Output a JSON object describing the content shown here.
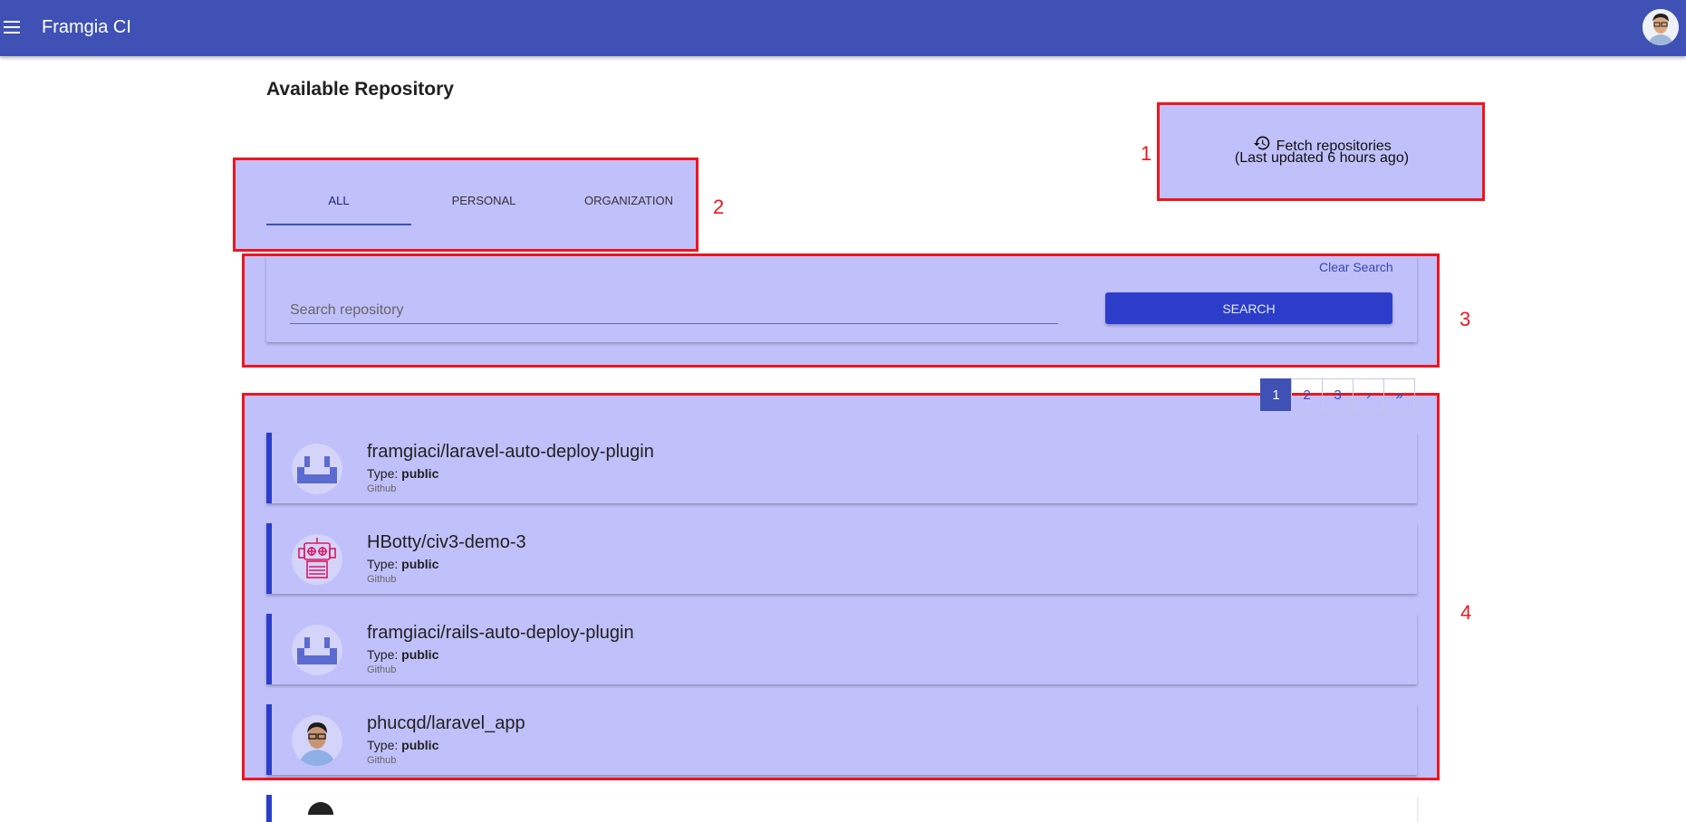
{
  "app": {
    "title": "Framgia CI"
  },
  "page": {
    "title": "Available Repository"
  },
  "fetch": {
    "label": "Fetch repositories",
    "last_updated": "(Last updated 6 hours ago)"
  },
  "tabs": [
    {
      "label": "ALL",
      "active": true
    },
    {
      "label": "PERSONAL",
      "active": false
    },
    {
      "label": "ORGANIZATION",
      "active": false
    }
  ],
  "search": {
    "clear_label": "Clear Search",
    "placeholder": "Search repository",
    "value": "",
    "button_label": "SEARCH"
  },
  "pagination": {
    "items": [
      "1",
      "2",
      "3",
      "›",
      "»"
    ],
    "current": "1"
  },
  "repositories": [
    {
      "name": "framgiaci/laravel-auto-deploy-plugin",
      "type_label": "Type:",
      "type_value": "public",
      "source": "Github",
      "avatar": "robot-face-blue-icon"
    },
    {
      "name": "HBotty/civ3-demo-3",
      "type_label": "Type:",
      "type_value": "public",
      "source": "Github",
      "avatar": "robot-red-icon"
    },
    {
      "name": "framgiaci/rails-auto-deploy-plugin",
      "type_label": "Type:",
      "type_value": "public",
      "source": "Github",
      "avatar": "robot-face-blue-icon"
    },
    {
      "name": "phucqd/laravel_app",
      "type_label": "Type:",
      "type_value": "public",
      "source": "Github",
      "avatar": "user-photo-avatar"
    }
  ],
  "annotations": [
    "1",
    "2",
    "3",
    "4"
  ],
  "colors": {
    "appbar": "#3f51b5",
    "accent": "#2c3ec9",
    "overlay": "#c0c0fb",
    "annotation": "#f0141e"
  }
}
